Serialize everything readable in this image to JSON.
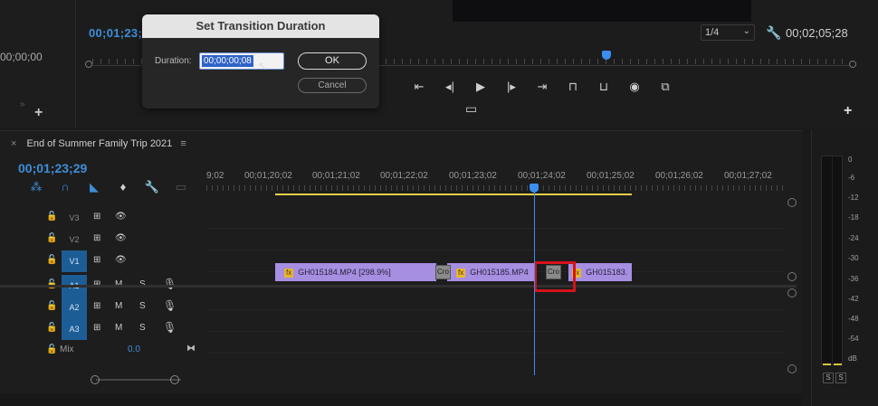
{
  "source_monitor": {
    "timecode": "00;00;00",
    "chevrons": "»",
    "add_label": "+"
  },
  "program_monitor": {
    "timecode": "00;01;23;",
    "resolution": "1/4",
    "duration": "00;02;05;28",
    "add_label": "+"
  },
  "dialog": {
    "title": "Set Transition Duration",
    "duration_label": "Duration:",
    "duration_value": "00;00;00;08",
    "ok_label": "OK",
    "cancel_label": "Cancel"
  },
  "timeline": {
    "sequence_name": "End of Summer Family Trip 2021",
    "timecode": "00;01;23;29",
    "ruler_labels": [
      "9;02",
      "00;01;20;02",
      "00;01;21;02",
      "00;01;22;02",
      "00;01;23;02",
      "00;01;24;02",
      "00;01;25;02",
      "00;01;26;02",
      "00;01;27;02"
    ],
    "tracks": [
      {
        "name": "V3",
        "type": "video",
        "targeted": false
      },
      {
        "name": "V2",
        "type": "video",
        "targeted": false
      },
      {
        "name": "V1",
        "type": "video",
        "targeted": true
      },
      {
        "name": "A1",
        "type": "audio",
        "targeted": true
      },
      {
        "name": "A2",
        "type": "audio",
        "targeted": true
      },
      {
        "name": "A3",
        "type": "audio",
        "targeted": true
      }
    ],
    "mute_label": "M",
    "solo_label": "S",
    "mix_label": "Mix",
    "mix_value": "0.0",
    "clips": [
      {
        "name": "GH015184.MP4 [298.9%]",
        "fx": "fx"
      },
      {
        "name": "GH015185.MP4",
        "fx": "fx"
      },
      {
        "name": "GH015183.",
        "fx": "fx"
      }
    ],
    "transitions": [
      "Cro",
      "Cro"
    ]
  },
  "audio_meter": {
    "scale": [
      "0",
      "-6",
      "-12",
      "-18",
      "-24",
      "-30",
      "-36",
      "-42",
      "-48",
      "-54",
      "dB"
    ],
    "solo_left": "S",
    "solo_right": "S"
  },
  "colors": {
    "accent_blue": "#3e8ed8",
    "clip_purple": "#a68ee0",
    "fx_yellow": "#e8b631",
    "highlight_red": "#d6121a"
  }
}
